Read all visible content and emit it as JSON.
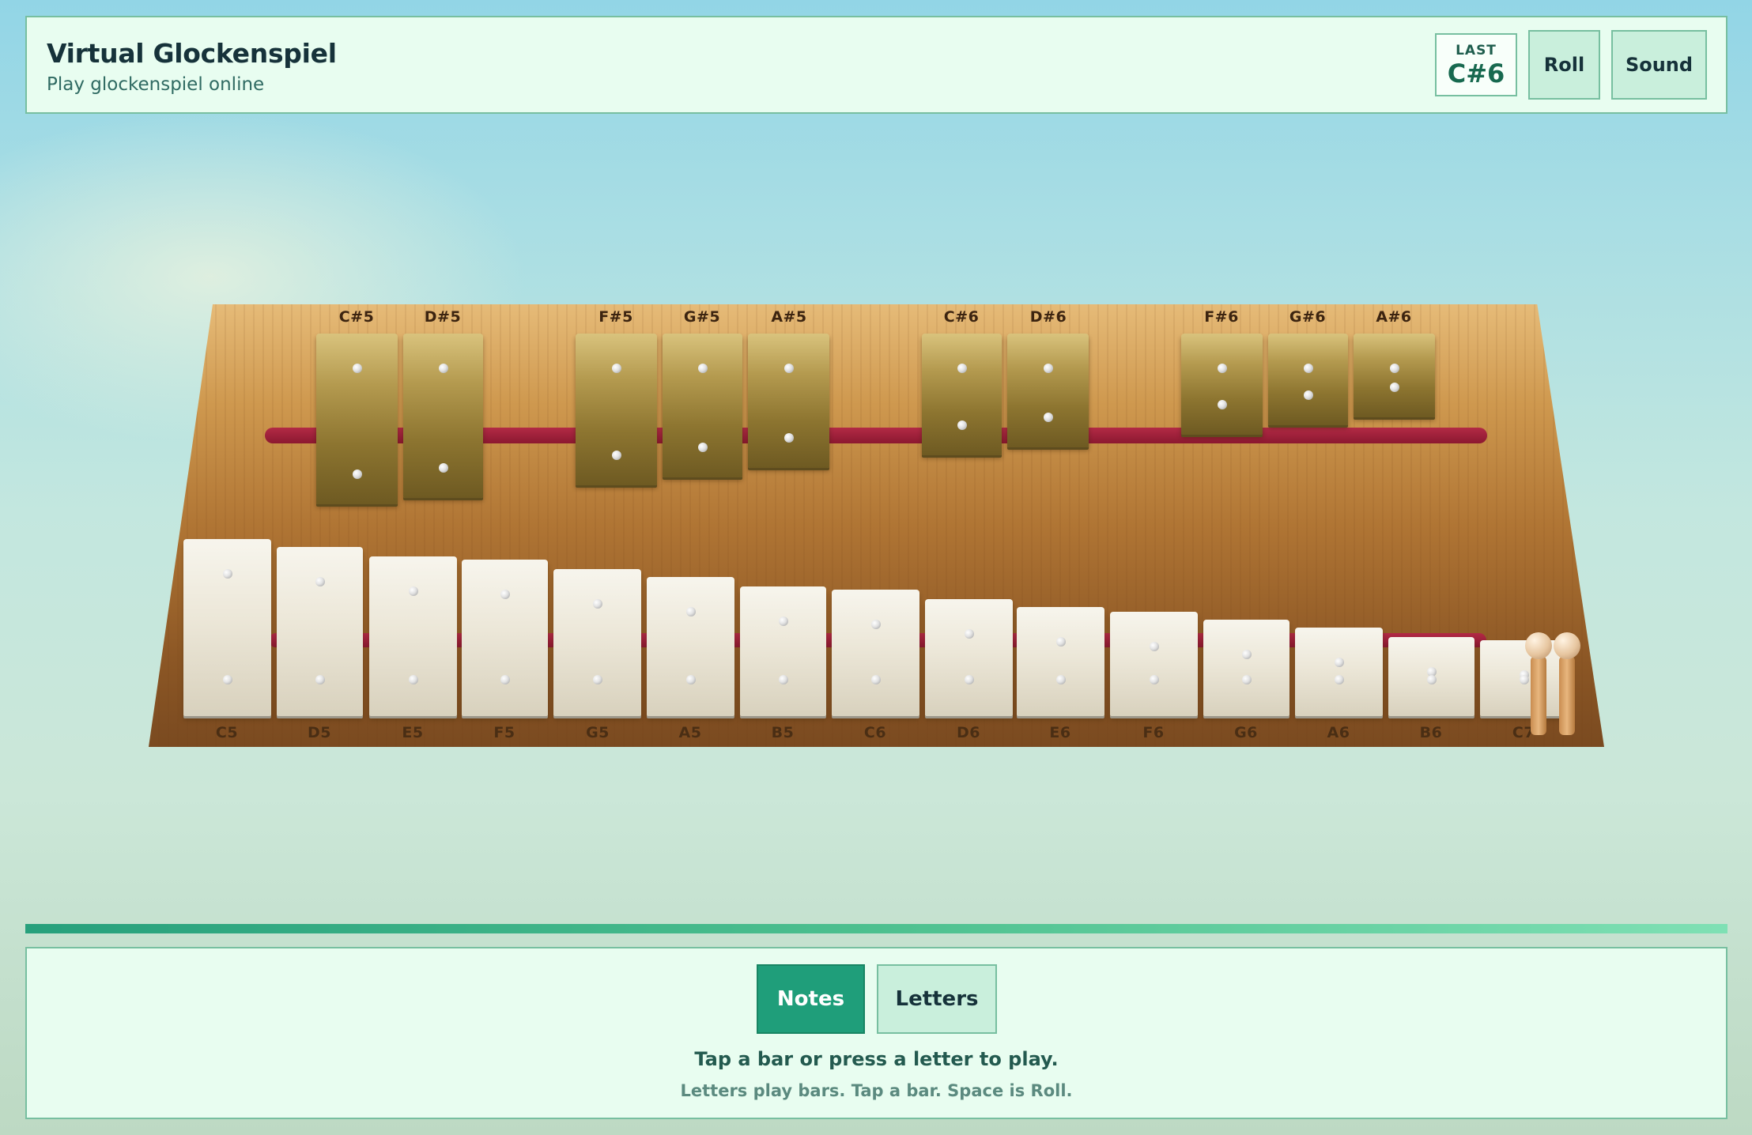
{
  "header": {
    "title": "Virtual Glockenspiel",
    "subtitle": "Play glockenspiel online",
    "last_label": "LAST",
    "last_note": "C#6",
    "roll_label": "Roll",
    "sound_label": "Sound"
  },
  "instrument": {
    "sharps": [
      "C#5",
      "D#5",
      "F#5",
      "G#5",
      "A#5",
      "C#6",
      "D#6",
      "F#6",
      "G#6",
      "A#6"
    ],
    "naturals": [
      "C5",
      "D5",
      "E5",
      "F5",
      "G5",
      "A5",
      "B5",
      "C6",
      "D6",
      "E6",
      "F6",
      "G6",
      "A6",
      "B6",
      "C7"
    ]
  },
  "controls": {
    "notes_label": "Notes",
    "letters_label": "Letters",
    "active_mode": "Notes"
  },
  "hints": {
    "primary": "Tap a bar or press a letter to play.",
    "secondary": "Letters play bars. Tap a bar. Space is Roll."
  }
}
